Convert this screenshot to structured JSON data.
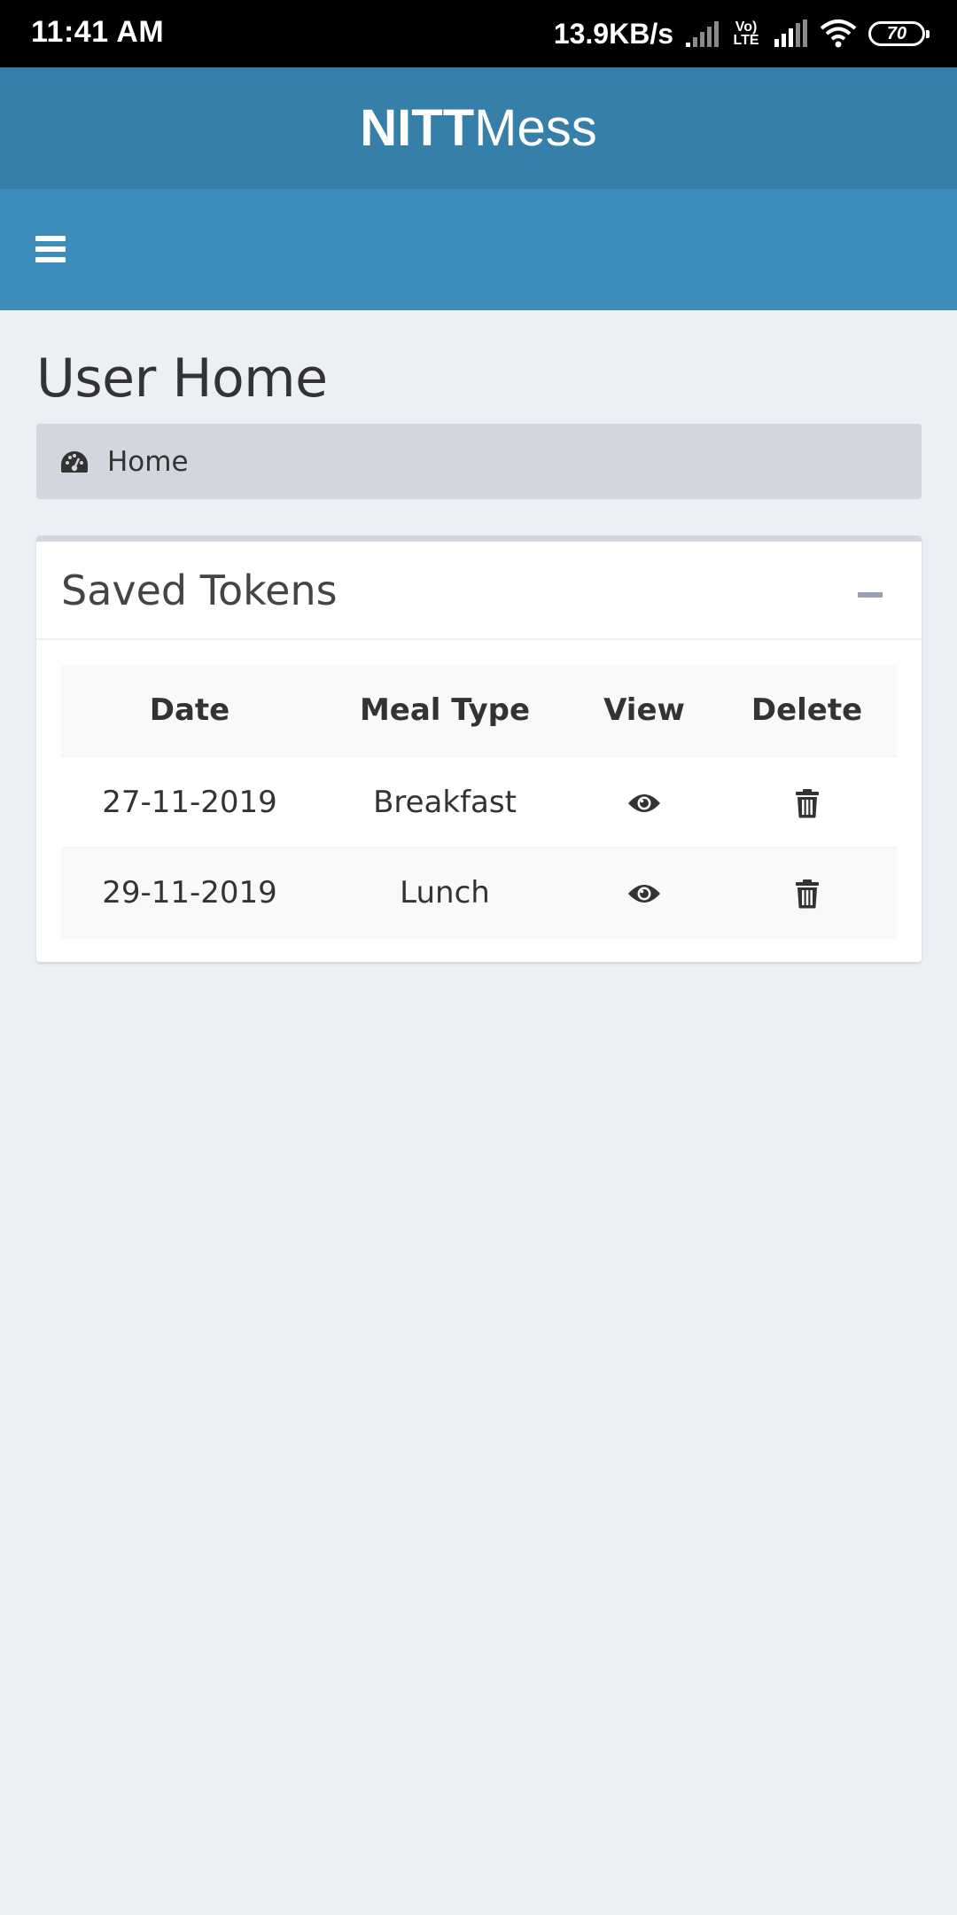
{
  "status_bar": {
    "time": "11:41 AM",
    "net_speed": "13.9KB/s",
    "volte_line1": "Vo)",
    "volte_line2": "LTE",
    "battery": "70",
    "icons": [
      "signal-icon",
      "volte-icon",
      "signal-icon",
      "wifi-icon",
      "battery-icon"
    ]
  },
  "header": {
    "logo_bold": "NITT",
    "logo_light": "Mess",
    "menu_icon": "hamburger-menu-icon",
    "colors": {
      "logo_bar": "#367fa9",
      "navbar": "#3c8dbc"
    }
  },
  "page": {
    "title": "User Home",
    "breadcrumb": {
      "icon": "dashboard-gauge-icon",
      "label": "Home"
    }
  },
  "saved_tokens": {
    "title": "Saved Tokens",
    "collapse_icon": "minus-icon",
    "columns": [
      "Date",
      "Meal Type",
      "View",
      "Delete"
    ],
    "rows": [
      {
        "date": "27-11-2019",
        "meal_type": "Breakfast",
        "view_icon": "eye-icon",
        "delete_icon": "trash-icon"
      },
      {
        "date": "29-11-2019",
        "meal_type": "Lunch",
        "view_icon": "eye-icon",
        "delete_icon": "trash-icon"
      }
    ]
  }
}
